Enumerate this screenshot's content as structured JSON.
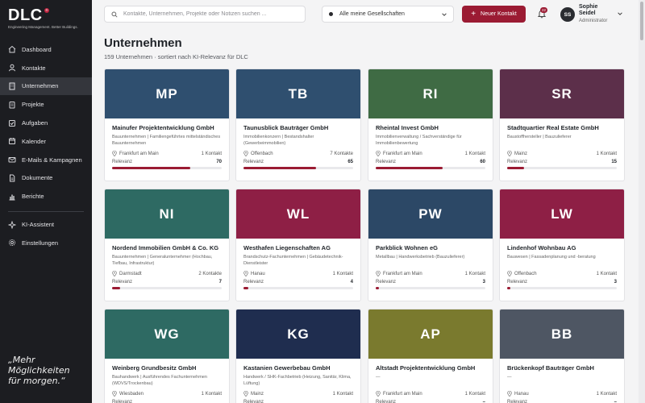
{
  "brand": {
    "name": "DLC",
    "registered": "®",
    "tagline": "Engineering Management. Better Buildings."
  },
  "sidebar": {
    "items": [
      {
        "label": "Dashboard",
        "icon": "home-icon"
      },
      {
        "label": "Kontakte",
        "icon": "user-icon"
      },
      {
        "label": "Unternehmen",
        "icon": "building-icon",
        "active": true
      },
      {
        "label": "Projekte",
        "icon": "clipboard-icon"
      },
      {
        "label": "Aufgaben",
        "icon": "checkbox-icon"
      },
      {
        "label": "Kalender",
        "icon": "calendar-icon"
      },
      {
        "label": "E-Mails & Kampagnen",
        "icon": "mail-icon"
      },
      {
        "label": "Dokumente",
        "icon": "document-icon"
      },
      {
        "label": "Berichte",
        "icon": "bar-chart-icon"
      }
    ],
    "secondary": [
      {
        "label": "KI-Assistent",
        "icon": "sparkle-icon"
      },
      {
        "label": "Einstellungen",
        "icon": "gear-icon"
      }
    ],
    "quote_lines": [
      "„Mehr",
      "Möglichkeiten",
      "für morgen.“"
    ]
  },
  "topbar": {
    "search_placeholder": "Kontakte, Unternehmen, Projekte oder Notizen suchen ...",
    "company_select": "Alle meine Gesellschaften",
    "new_contact": "Neuer Kontakt",
    "notifications_count": "22",
    "user": {
      "initials": "SS",
      "first": "Sophie",
      "last": "Seidel",
      "role": "Administrator"
    }
  },
  "page": {
    "title": "Unternehmen",
    "subtitle": "159 Unternehmen · sortiert nach KI-Relevanz für DLC"
  },
  "relevance_label": "Relevanz",
  "colors": {
    "accent": "#9b1b33"
  },
  "companies": [
    {
      "initials": "MP",
      "color": "#2f4f6f",
      "name": "Mainufer Projektentwicklung GmbH",
      "desc": "Bauunternehmen | Familiengeführtes mittelständisches Bauunternehmen",
      "location": "Frankfurt am Main",
      "contacts": "1 Kontakt",
      "relevance": "70"
    },
    {
      "initials": "TB",
      "color": "#2f4f6f",
      "name": "Taunusblick Bauträger GmbH",
      "desc": "Immobilienkonzern | Bestandshalter (Gewerbeimmobilien)",
      "location": "Offenbach",
      "contacts": "7 Kontakte",
      "relevance": "65"
    },
    {
      "initials": "RI",
      "color": "#3f6b44",
      "name": "Rheintal Invest GmbH",
      "desc": "Immobilienverwaltung / Sachverständige für Immobilienbewertung",
      "location": "Frankfurt am Main",
      "contacts": "1 Kontakt",
      "relevance": "60"
    },
    {
      "initials": "SR",
      "color": "#5c2f4a",
      "name": "Stadtquartier Real Estate GmbH",
      "desc": "Baustoffhersteller | Bauzulieferer",
      "location": "Mainz",
      "contacts": "1 Kontakt",
      "relevance": "15"
    },
    {
      "initials": "NI",
      "color": "#2e6a63",
      "name": "Nordend Immobilien GmbH & Co. KG",
      "desc": "Bauunternehmen | Generalunternehmer (Hochbau, Tiefbau, Infrastruktur)",
      "location": "Darmstadt",
      "contacts": "2 Kontakte",
      "relevance": "7"
    },
    {
      "initials": "WL",
      "color": "#8e1f45",
      "name": "Westhafen Liegenschaften AG",
      "desc": "Brandschutz-Fachunternehmen | Gebäudetechnik-Dienstleister",
      "location": "Hanau",
      "contacts": "1 Kontakt",
      "relevance": "4"
    },
    {
      "initials": "PW",
      "color": "#2c4866",
      "name": "Parkblick Wohnen eG",
      "desc": "Metallbau | Handwerksbetrieb (Bauzulieferer)",
      "location": "Frankfurt am Main",
      "contacts": "1 Kontakt",
      "relevance": "3"
    },
    {
      "initials": "LW",
      "color": "#8e1f45",
      "name": "Lindenhof Wohnbau AG",
      "desc": "Bauwesen | Fassadenplanung und -beratung",
      "location": "Offenbach",
      "contacts": "1 Kontakt",
      "relevance": "3"
    },
    {
      "initials": "WG",
      "color": "#2e6a63",
      "name": "Weinberg Grundbesitz GmbH",
      "desc": "Bauhandwerk | Ausführendes Fachunternehmen (WDVS/Trockenbau)",
      "location": "Wiesbaden",
      "contacts": "1 Kontakt",
      "relevance": ""
    },
    {
      "initials": "KG",
      "color": "#1f2d4f",
      "name": "Kastanien Gewerbebau GmbH",
      "desc": "Handwerk / SHK-Fachbetrieb (Heizung, Sanitär, Klima, Lüftung)",
      "location": "Mainz",
      "contacts": "1 Kontakt",
      "relevance": ""
    },
    {
      "initials": "AP",
      "color": "#7a7a2e",
      "name": "Altstadt Projektentwicklung GmbH",
      "desc": "—",
      "location": "Frankfurt am Main",
      "contacts": "1 Kontakt",
      "relevance": "–"
    },
    {
      "initials": "BB",
      "color": "#4e5663",
      "name": "Brückenkopf Bauträger GmbH",
      "desc": "—",
      "location": "Hanau",
      "contacts": "1 Kontakt",
      "relevance": "–"
    }
  ]
}
